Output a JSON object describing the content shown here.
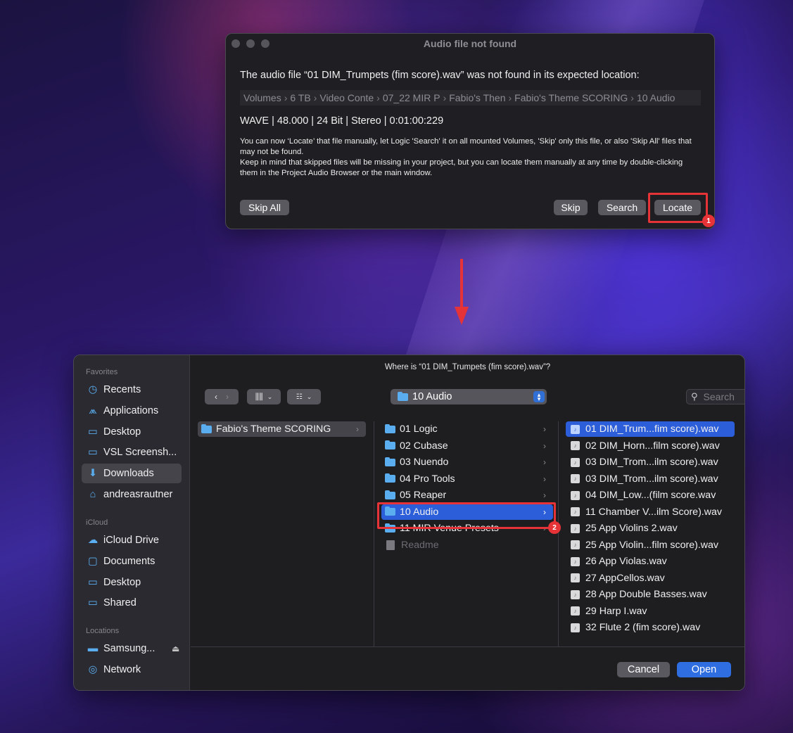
{
  "alert": {
    "title": "Audio file not found",
    "message": "The audio file “01 DIM_Trumpets (fim score).wav” was not found in its expected location:",
    "path": [
      "Volumes",
      "6 TB",
      "Video Conte",
      "07_22 MIR P",
      "Fabio's Then",
      "Fabio's Theme SCORING",
      "10 Audio"
    ],
    "path_separator": "›",
    "info": "WAVE | 48.000 | 24 Bit | Stereo | 0:01:00:229",
    "description": "You can now ‘Locate’ that file manually, let Logic 'Search' it on all mounted Volumes, 'Skip' only this file, or also 'Skip All' files that may not be found.\nKeep in mind that skipped files will be missing in your project, but you can locate them manually at any time by double-clicking them in the Project Audio Browser or the main window.",
    "buttons": {
      "skip_all": "Skip All",
      "skip": "Skip",
      "search": "Search",
      "locate": "Locate"
    }
  },
  "annotations": {
    "badge1": "1",
    "badge2": "2",
    "color": "#e63338"
  },
  "finder": {
    "title": "Where is “01 DIM_Trumpets (fim score).wav”?",
    "current_folder": "10 Audio",
    "search_placeholder": "Search",
    "sidebar": {
      "favorites_label": "Favorites",
      "favorites": [
        {
          "label": "Recents",
          "icon": "clock-icon"
        },
        {
          "label": "Applications",
          "icon": "applications-icon"
        },
        {
          "label": "Desktop",
          "icon": "desktop-icon"
        },
        {
          "label": "VSL Screensh...",
          "icon": "folder-icon"
        },
        {
          "label": "Downloads",
          "icon": "download-icon"
        },
        {
          "label": "andreasrautner",
          "icon": "home-icon"
        }
      ],
      "icloud_label": "iCloud",
      "icloud": [
        {
          "label": "iCloud Drive",
          "icon": "cloud-icon"
        },
        {
          "label": "Documents",
          "icon": "document-icon"
        },
        {
          "label": "Desktop",
          "icon": "desktop-icon"
        },
        {
          "label": "Shared",
          "icon": "shared-folder-icon"
        }
      ],
      "locations_label": "Locations",
      "locations": [
        {
          "label": "Samsung...",
          "icon": "drive-icon"
        },
        {
          "label": "Network",
          "icon": "globe-icon"
        }
      ]
    },
    "column1": [
      "Fabio's Theme SCORING"
    ],
    "column2": [
      {
        "name": "01 Logic",
        "folder": true
      },
      {
        "name": "02 Cubase",
        "folder": true
      },
      {
        "name": "03 Nuendo",
        "folder": true
      },
      {
        "name": "04 Pro Tools",
        "folder": true
      },
      {
        "name": "05 Reaper",
        "folder": true
      },
      {
        "name": "10 Audio",
        "folder": true
      },
      {
        "name": "11 MIR Venue Presets",
        "folder": true
      },
      {
        "name": "Readme",
        "folder": false
      }
    ],
    "column3": [
      "01 DIM_Trum...fim score).wav",
      "02 DIM_Horn...film score).wav",
      "03 DIM_Trom...ilm score).wav",
      "03 DIM_Trom...ilm score).wav",
      "04 DIM_Low...(film score.wav",
      "11 Chamber V...ilm Score).wav",
      "25 App Violins 2.wav",
      "25 App Violin...film score).wav",
      "26 App Violas.wav",
      "27 AppCellos.wav",
      "28 App Double Basses.wav",
      "29 Harp I.wav",
      "32 Flute 2 (fim score).wav"
    ],
    "buttons": {
      "cancel": "Cancel",
      "open": "Open"
    }
  }
}
